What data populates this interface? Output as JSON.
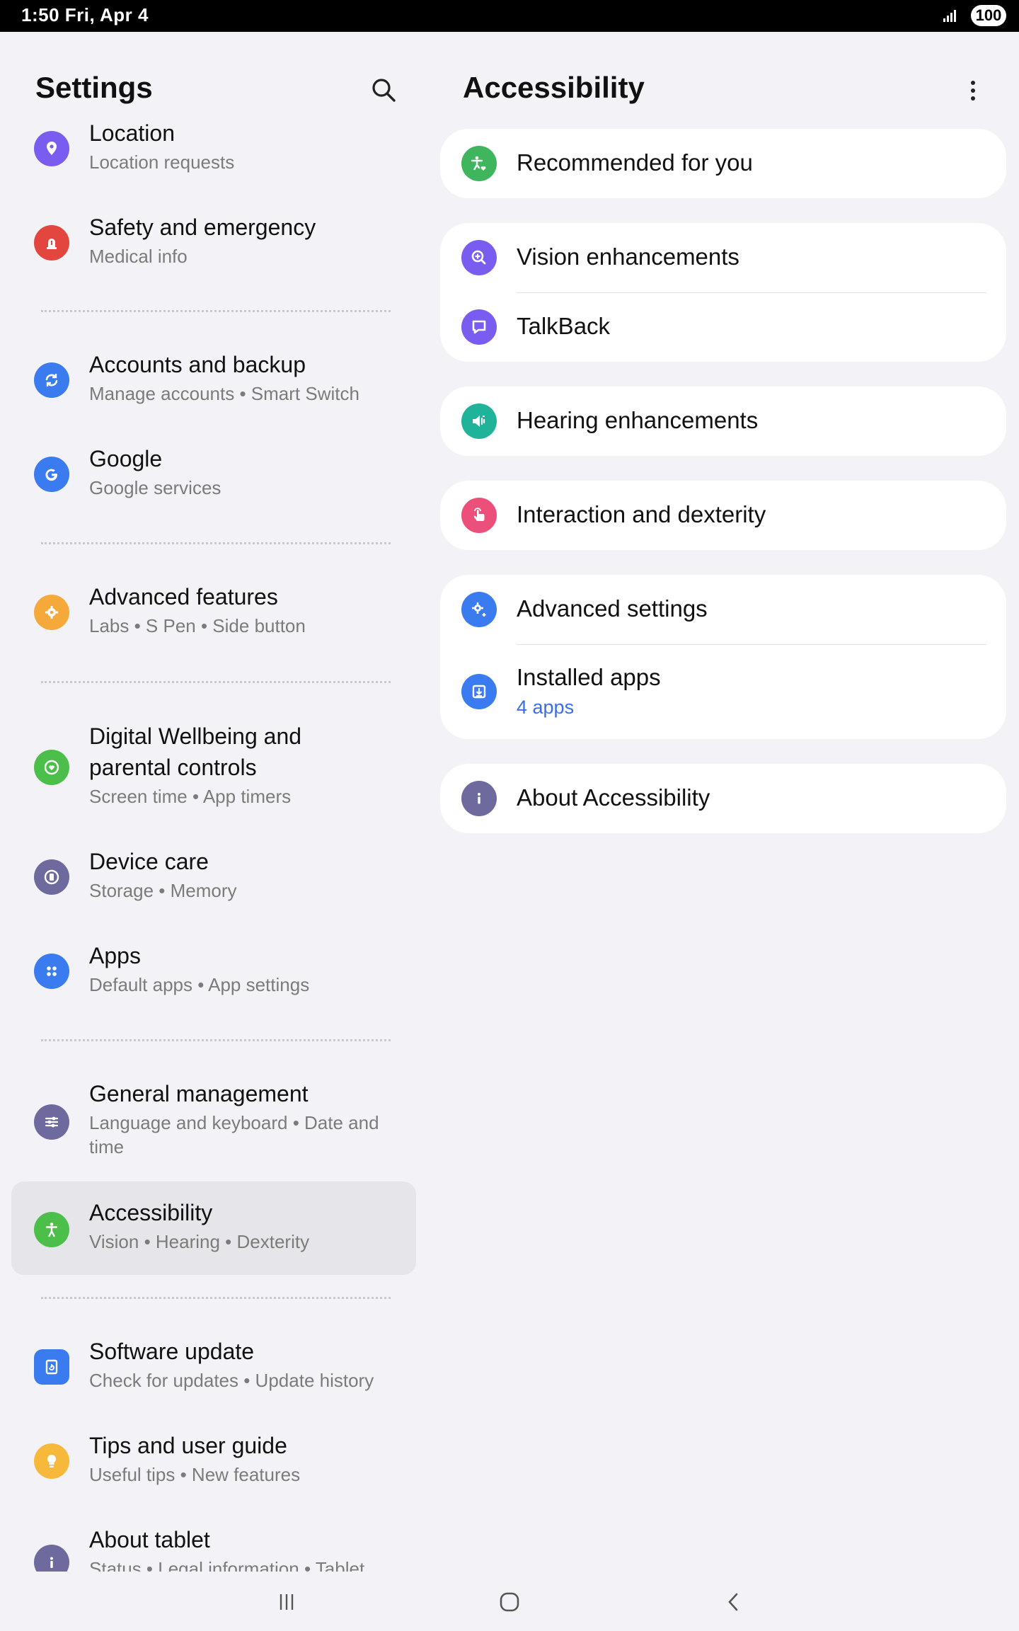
{
  "status_bar": {
    "time": "1:50  Fri, Apr 4",
    "battery": "100"
  },
  "left_pane": {
    "title": "Settings",
    "items": [
      {
        "title": "Location",
        "subtitle": "Location requests",
        "icon": "location-pin-icon",
        "color": "#7b5cf0"
      },
      {
        "title": "Safety and emergency",
        "subtitle": "Medical info",
        "icon": "siren-icon",
        "color": "#e2463f"
      },
      {
        "title": "Accounts and backup",
        "subtitle": "Manage accounts  •  Smart Switch",
        "icon": "sync-icon",
        "color": "#3b7bf0"
      },
      {
        "title": "Google",
        "subtitle": "Google services",
        "icon": "google-icon",
        "color": "#3b7bf0"
      },
      {
        "title": "Advanced features",
        "subtitle": "Labs  •  S Pen  •  Side button",
        "icon": "puzzle-gear-icon",
        "color": "#f6a93b"
      },
      {
        "title": "Digital Wellbeing and",
        "title2": "parental controls",
        "subtitle": "Screen time  •  App timers",
        "icon": "heart-circle-icon",
        "color": "#4cbf4a"
      },
      {
        "title": "Device care",
        "subtitle": "Storage  •  Memory",
        "icon": "device-care-icon",
        "color": "#6e6a9e"
      },
      {
        "title": "Apps",
        "subtitle": "Default apps  •  App settings",
        "icon": "apps-grid-icon",
        "color": "#3b7bf0"
      },
      {
        "title": "General management",
        "subtitle": "Language and keyboard  •  Date and",
        "subtitle2": "time",
        "icon": "sliders-icon",
        "color": "#6e6a9e"
      },
      {
        "title": "Accessibility",
        "subtitle": "Vision  •  Hearing  •  Dexterity",
        "icon": "accessibility-person-icon",
        "color": "#4cbf4a"
      },
      {
        "title": "Software update",
        "subtitle": "Check for updates  •  Update history",
        "icon": "software-update-icon",
        "color": "#3b7bf0"
      },
      {
        "title": "Tips and user guide",
        "subtitle": "Useful tips  •  New features",
        "icon": "lightbulb-icon",
        "color": "#f6b93b"
      },
      {
        "title": "About tablet",
        "subtitle": "Status  •  Legal information  •  Tablet",
        "icon": "info-icon",
        "color": "#6e6a9e"
      }
    ]
  },
  "right_pane": {
    "title": "Accessibility",
    "recommended": "Recommended for you",
    "vision": "Vision enhancements",
    "talkback": "TalkBack",
    "hearing": "Hearing enhancements",
    "interaction": "Interaction and dexterity",
    "advanced": "Advanced settings",
    "installed": "Installed apps",
    "installed_sub": "4 apps",
    "about": "About Accessibility"
  }
}
